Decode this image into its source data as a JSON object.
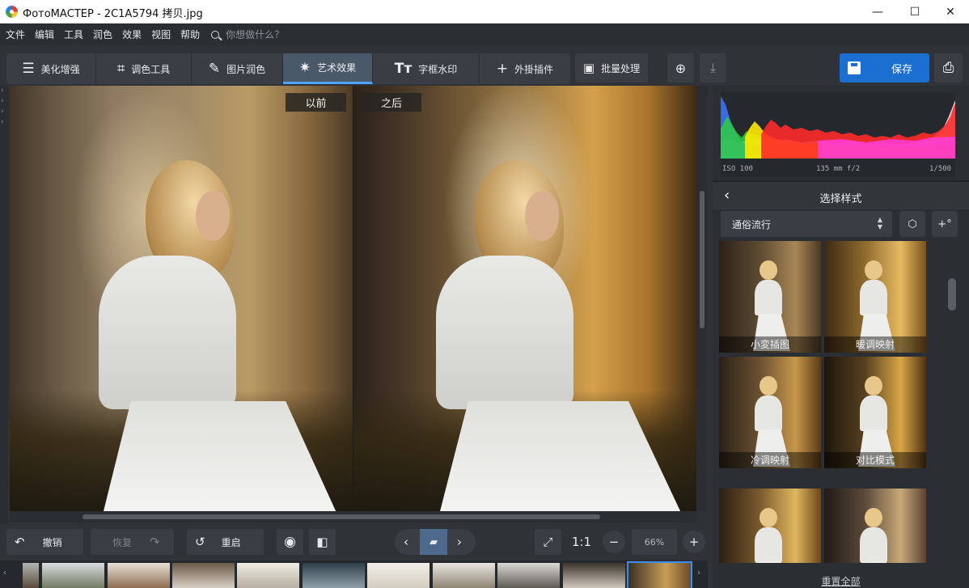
{
  "window": {
    "title": "ФотоМАСТЕР - 2C1A5794 拷贝.jpg",
    "minimize": "—",
    "maximize": "☐",
    "close": "✕"
  },
  "menu": {
    "items": [
      "文件",
      "编辑",
      "工具",
      "润色",
      "效果",
      "视图",
      "帮助"
    ],
    "search_placeholder": "你想做什么？"
  },
  "toolbar": {
    "tabs": [
      {
        "label": "美化增强",
        "icon": "sliders-icon"
      },
      {
        "label": "调色工具",
        "icon": "crop-icon"
      },
      {
        "label": "图片润色",
        "icon": "brush-icon"
      },
      {
        "label": "艺术效果",
        "icon": "magic-wand-icon",
        "active": true
      },
      {
        "label": "字框水印",
        "icon": "text-icon"
      },
      {
        "label": "外掛插件",
        "icon": "plus-icon"
      }
    ],
    "batch_label": "批量处理",
    "save_label": "保存"
  },
  "viewer": {
    "before_label": "以前",
    "after_label": "之后"
  },
  "bottom": {
    "undo_label": "撤销",
    "redo_label": "恢复",
    "reset_label": "重启",
    "ratio_label": "1:1",
    "zoom_value": "66%"
  },
  "histogram": {
    "iso": "ISO 100",
    "lens": "135 mm f/2",
    "shutter": "1/500"
  },
  "styles_panel": {
    "title": "选择样式",
    "category": "通俗流行",
    "presets": [
      "小変插图",
      "暖调映射",
      "冷调映射",
      "对比模式",
      "",
      ""
    ],
    "reset_all": "重置全部"
  },
  "colors": {
    "accent": "#1a6fd1",
    "active_tab": "#4a5969",
    "panel": "#2b2e33"
  }
}
